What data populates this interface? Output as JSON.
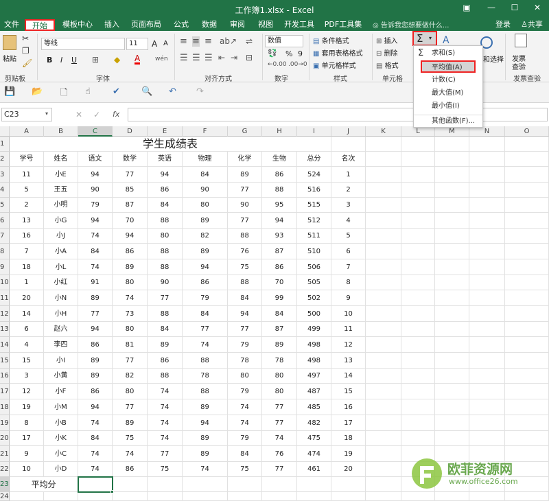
{
  "window": {
    "title": "工作簿1.xlsx - Excel",
    "restore_icon": "ribbon-display-icon",
    "minimize_label": "—",
    "maximize_label": "☐",
    "close_label": "✕"
  },
  "tabs": [
    {
      "label": "文件"
    },
    {
      "label": "开始",
      "active": true
    },
    {
      "label": "模板中心"
    },
    {
      "label": "插入"
    },
    {
      "label": "页面布局"
    },
    {
      "label": "公式"
    },
    {
      "label": "数据"
    },
    {
      "label": "审阅"
    },
    {
      "label": "视图"
    },
    {
      "label": "开发工具"
    },
    {
      "label": "PDF工具集"
    }
  ],
  "tell_me": "告诉我您想要做什么...",
  "account": {
    "login": "登录",
    "share": "共享"
  },
  "ribbon": {
    "clipboard": {
      "paste": "粘贴",
      "label": "剪贴板"
    },
    "font": {
      "name": "等线",
      "size": "11",
      "grow": "A",
      "shrink": "A",
      "bold": "B",
      "italic": "I",
      "underline": "U",
      "phonetic": "wén",
      "label": "字体"
    },
    "alignment": {
      "label": "对齐方式"
    },
    "number": {
      "format": "数值",
      "percent": "%",
      "comma": "9",
      "label": "数字"
    },
    "styles": {
      "conditional": "条件格式",
      "table": "套用表格格式",
      "cell": "单元格样式",
      "label": "样式"
    },
    "cells": {
      "insert": "插入",
      "delete": "删除",
      "format": "格式",
      "label": "单元格"
    },
    "editing": {
      "find_select": "和选择",
      "sort": "A"
    },
    "invoice": {
      "title_line1": "发票",
      "title_line2": "查验",
      "label": "发票查验"
    }
  },
  "autosum_menu": [
    {
      "label": "求和(S)"
    },
    {
      "label": "平均值(A)",
      "highlighted": true
    },
    {
      "label": "计数(C)"
    },
    {
      "label": "最大值(M)"
    },
    {
      "label": "最小值(I)"
    },
    {
      "label": "其他函数(F)..."
    }
  ],
  "formula_bar": {
    "name_box": "C23",
    "cancel": "✕",
    "enter": "✓",
    "fx": "fx",
    "value": ""
  },
  "columns": [
    "A",
    "B",
    "C",
    "D",
    "E",
    "F",
    "G",
    "H",
    "I",
    "J",
    "K",
    "L",
    "M",
    "N",
    "O"
  ],
  "selected_column": "C",
  "selected_row": "23",
  "row_numbers": [
    "1",
    "2",
    "3",
    "4",
    "5",
    "6",
    "7",
    "8",
    "9",
    "10",
    "11",
    "12",
    "13",
    "14",
    "15",
    "16",
    "17",
    "18",
    "19",
    "20",
    "21",
    "22",
    "23",
    "24"
  ],
  "sheet": {
    "title": "学生成绩表",
    "headers": [
      "学号",
      "姓名",
      "语文",
      "数学",
      "英语",
      "物理",
      "化学",
      "生物",
      "总分",
      "名次"
    ],
    "rows": [
      [
        "11",
        "小E",
        "94",
        "77",
        "94",
        "84",
        "89",
        "86",
        "524",
        "1"
      ],
      [
        "5",
        "王五",
        "90",
        "85",
        "86",
        "90",
        "77",
        "88",
        "516",
        "2"
      ],
      [
        "2",
        "小明",
        "79",
        "87",
        "84",
        "80",
        "90",
        "95",
        "515",
        "3"
      ],
      [
        "13",
        "小G",
        "94",
        "70",
        "88",
        "89",
        "77",
        "94",
        "512",
        "4"
      ],
      [
        "16",
        "小J",
        "74",
        "94",
        "80",
        "82",
        "88",
        "93",
        "511",
        "5"
      ],
      [
        "7",
        "小A",
        "84",
        "86",
        "88",
        "89",
        "76",
        "87",
        "510",
        "6"
      ],
      [
        "18",
        "小L",
        "74",
        "89",
        "88",
        "94",
        "75",
        "86",
        "506",
        "7"
      ],
      [
        "1",
        "小红",
        "91",
        "80",
        "90",
        "86",
        "88",
        "70",
        "505",
        "8"
      ],
      [
        "20",
        "小N",
        "89",
        "74",
        "77",
        "79",
        "84",
        "99",
        "502",
        "9"
      ],
      [
        "14",
        "小H",
        "77",
        "73",
        "88",
        "84",
        "94",
        "84",
        "500",
        "10"
      ],
      [
        "6",
        "赵六",
        "94",
        "80",
        "84",
        "77",
        "77",
        "87",
        "499",
        "11"
      ],
      [
        "4",
        "李四",
        "86",
        "81",
        "89",
        "74",
        "79",
        "89",
        "498",
        "12"
      ],
      [
        "15",
        "小I",
        "89",
        "77",
        "86",
        "88",
        "78",
        "78",
        "498",
        "13"
      ],
      [
        "3",
        "小黄",
        "89",
        "82",
        "88",
        "78",
        "80",
        "80",
        "497",
        "14"
      ],
      [
        "12",
        "小F",
        "86",
        "80",
        "74",
        "88",
        "79",
        "80",
        "487",
        "15"
      ],
      [
        "19",
        "小M",
        "94",
        "77",
        "74",
        "89",
        "74",
        "77",
        "485",
        "16"
      ],
      [
        "8",
        "小B",
        "74",
        "89",
        "74",
        "94",
        "74",
        "77",
        "482",
        "17"
      ],
      [
        "17",
        "小K",
        "84",
        "75",
        "74",
        "89",
        "79",
        "74",
        "475",
        "18"
      ],
      [
        "9",
        "小C",
        "74",
        "74",
        "77",
        "89",
        "84",
        "76",
        "474",
        "19"
      ],
      [
        "10",
        "小D",
        "74",
        "86",
        "75",
        "74",
        "75",
        "77",
        "461",
        "20"
      ]
    ],
    "average_label": "平均分"
  },
  "watermark": {
    "brand": "欧菲资源网",
    "url": "www.office26.com"
  },
  "colors": {
    "excel_green": "#217346",
    "highlight_red": "#e22222"
  }
}
